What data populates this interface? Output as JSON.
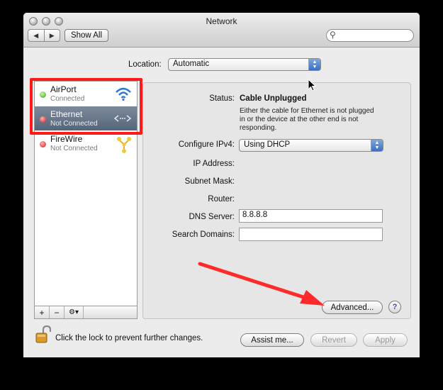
{
  "window": {
    "title": "Network"
  },
  "toolbar": {
    "back": "◀",
    "forward": "▶",
    "show_all": "Show All",
    "search_icon": "search-icon"
  },
  "location": {
    "label": "Location:",
    "value": "Automatic"
  },
  "services": [
    {
      "name": "AirPort",
      "status": "Connected",
      "dot_color": "#3ea31f",
      "icon": "wifi-icon"
    },
    {
      "name": "Ethernet",
      "status": "Not Connected",
      "dot_color": "#d21a1a",
      "icon": "ethernet-icon"
    },
    {
      "name": "FireWire",
      "status": "Not Connected",
      "dot_color": "#d21a1a",
      "icon": "firewire-icon"
    }
  ],
  "sidebar_actions": {
    "add": "+",
    "remove": "−",
    "gear": "⚙▾"
  },
  "detail": {
    "status_label": "Status:",
    "status_value": "Cable Unplugged",
    "status_desc_1": "Either the cable for Ethernet is not plugged",
    "status_desc_2": "in or the device at the other end is not",
    "status_desc_3": "responding.",
    "configure_label": "Configure IPv4:",
    "configure_value": "Using DHCP",
    "ip_label": "IP Address:",
    "subnet_label": "Subnet Mask:",
    "router_label": "Router:",
    "dns_label": "DNS Server:",
    "dns_value": "8.8.8.8",
    "search_domains_label": "Search Domains:",
    "search_domains_value": "",
    "advanced_button": "Advanced...",
    "help_button": "?"
  },
  "footer": {
    "lock_text": "Click the lock to prevent further changes.",
    "assist_button": "Assist me...",
    "revert_button": "Revert",
    "apply_button": "Apply"
  },
  "annotations": {
    "highlight_color": "#ff1a1a",
    "arrow_color": "#ff2a2a"
  }
}
